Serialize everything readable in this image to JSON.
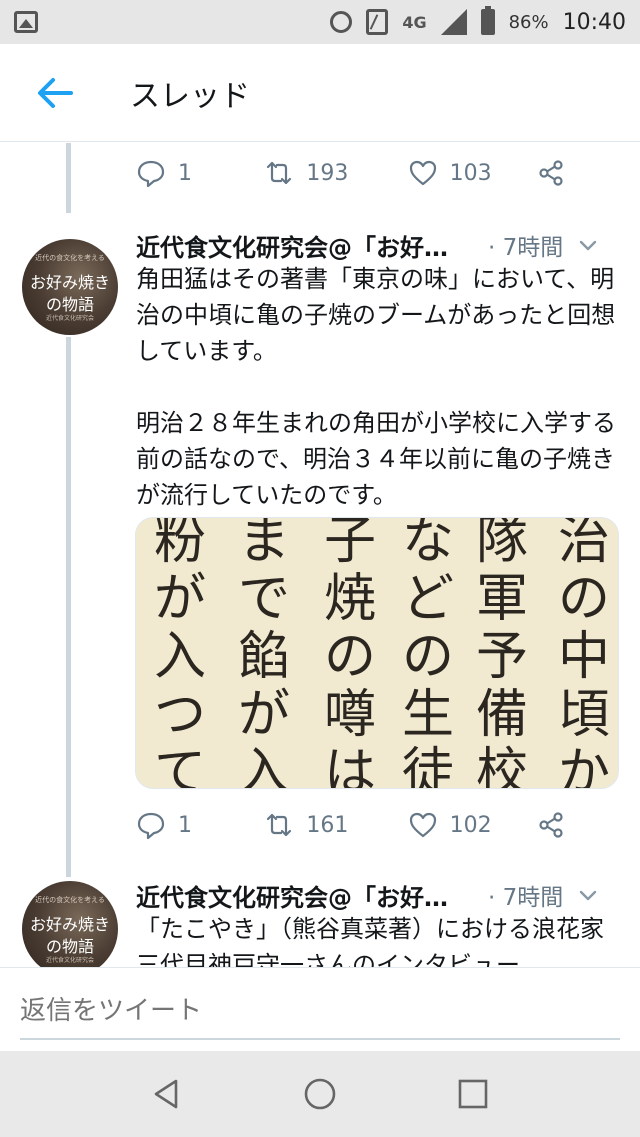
{
  "status_bar": {
    "network": "4G",
    "battery_percent": "86%",
    "time": "10:40",
    "icons": [
      "gallery-icon",
      "alarm-icon",
      "nfc-icon",
      "signal-icon",
      "battery-icon"
    ]
  },
  "header": {
    "title": "スレッド",
    "back_icon": "arrow-left-icon",
    "accent_color": "#1da1f2"
  },
  "previous_tweet_actions": {
    "reply_count": "1",
    "retweet_count": "193",
    "like_count": "103"
  },
  "tweets": [
    {
      "name": "近代食文化研究会@「お好…",
      "time": "· 7時間",
      "avatar": {
        "top_text": "近代の食文化を考える",
        "line1": "お好み焼き",
        "line2": "の物語",
        "sub_text": "近代食文化研究会"
      },
      "text": "角田猛はその著書「東京の味」において、明治の中頃に亀の子焼のブームがあったと回想しています。\n\n明治２８年生まれの角田が小学校に入学する前の話なので、明治３４年以前に亀の子焼きが流行していたのです。",
      "media_columns": [
        "治の中頃か",
        "隊軍予備校（",
        "などの生徒",
        "子焼の噂は",
        "まで餡が入つ",
        "粉が入つて"
      ],
      "reply_count": "1",
      "retweet_count": "161",
      "like_count": "102"
    },
    {
      "name": "近代食文化研究会@「お好…",
      "time": "· 7時間",
      "avatar": {
        "top_text": "近代の食文化を考える",
        "line1": "お好み焼き",
        "line2": "の物語",
        "sub_text": "近代食文化研究会"
      },
      "text": "「たこやき」（熊谷真菜著）における浪花家三代目神戸守一さんのインタビュー"
    }
  ],
  "reply_bar": {
    "placeholder": "返信をツイート"
  },
  "nav_bar": {
    "icons": [
      "back-triangle-icon",
      "home-circle-icon",
      "recents-square-icon"
    ]
  }
}
